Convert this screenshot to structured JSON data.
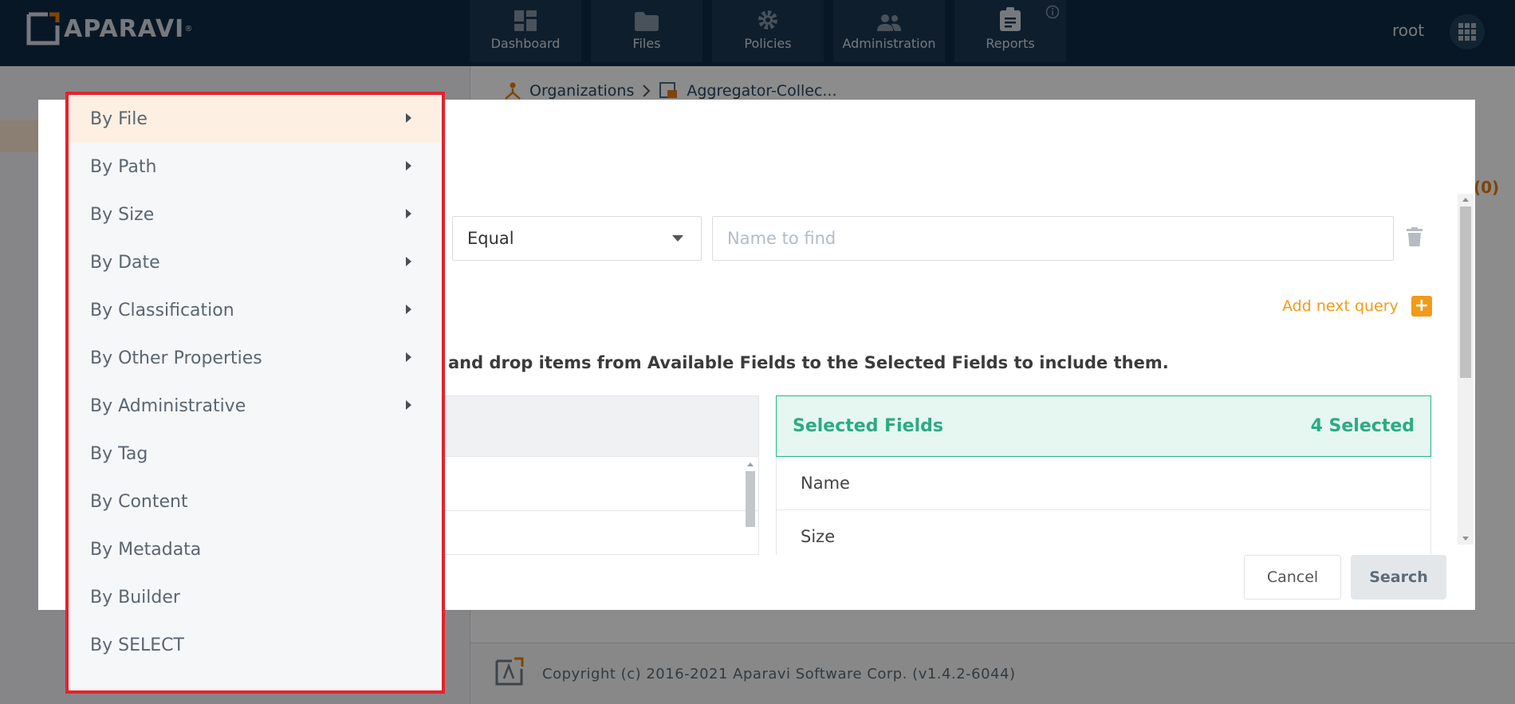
{
  "app": {
    "brand": "APARAVI",
    "brand_mark": "®",
    "user": "root"
  },
  "nav": [
    {
      "label": "Dashboard",
      "icon": "dashboard-icon"
    },
    {
      "label": "Files",
      "icon": "folder-icon"
    },
    {
      "label": "Policies",
      "icon": "gear-icon"
    },
    {
      "label": "Administration",
      "icon": "users-icon"
    },
    {
      "label": "Reports",
      "icon": "clipboard-icon"
    }
  ],
  "background": {
    "breadcrumb": [
      "Organizations",
      "Aggregator-Collec..."
    ],
    "count": "(0)",
    "footer": "Copyright (c) 2016-2021 Aparavi Software Corp. (v1.4.2-6044)"
  },
  "modal": {
    "operator": "Equal",
    "name_placeholder": "Name to find",
    "add_query": "Add next query",
    "instructions": "and drop items from Available Fields to the Selected Fields to include them.",
    "selected_fields": {
      "title": "Selected Fields",
      "count": "4 Selected",
      "items": [
        "Name",
        "Size"
      ]
    },
    "cancel": "Cancel",
    "search": "Search"
  },
  "menu": {
    "items": [
      {
        "label": "By File",
        "submenu": true,
        "active": true
      },
      {
        "label": "By Path",
        "submenu": true
      },
      {
        "label": "By Size",
        "submenu": true
      },
      {
        "label": "By Date",
        "submenu": true
      },
      {
        "label": "By Classification",
        "submenu": true
      },
      {
        "label": "By Other Properties",
        "submenu": true
      },
      {
        "label": "By Administrative",
        "submenu": true
      },
      {
        "label": "By Tag",
        "submenu": false
      },
      {
        "label": "By Content",
        "submenu": false
      },
      {
        "label": "By Metadata",
        "submenu": false
      },
      {
        "label": "By Builder",
        "submenu": false
      },
      {
        "label": "By SELECT",
        "submenu": false
      }
    ]
  },
  "colors": {
    "topbar": "#0f2b45",
    "accent_orange": "#f39a17",
    "selected_green": "#2bab82",
    "menu_border": "#e3222d"
  }
}
